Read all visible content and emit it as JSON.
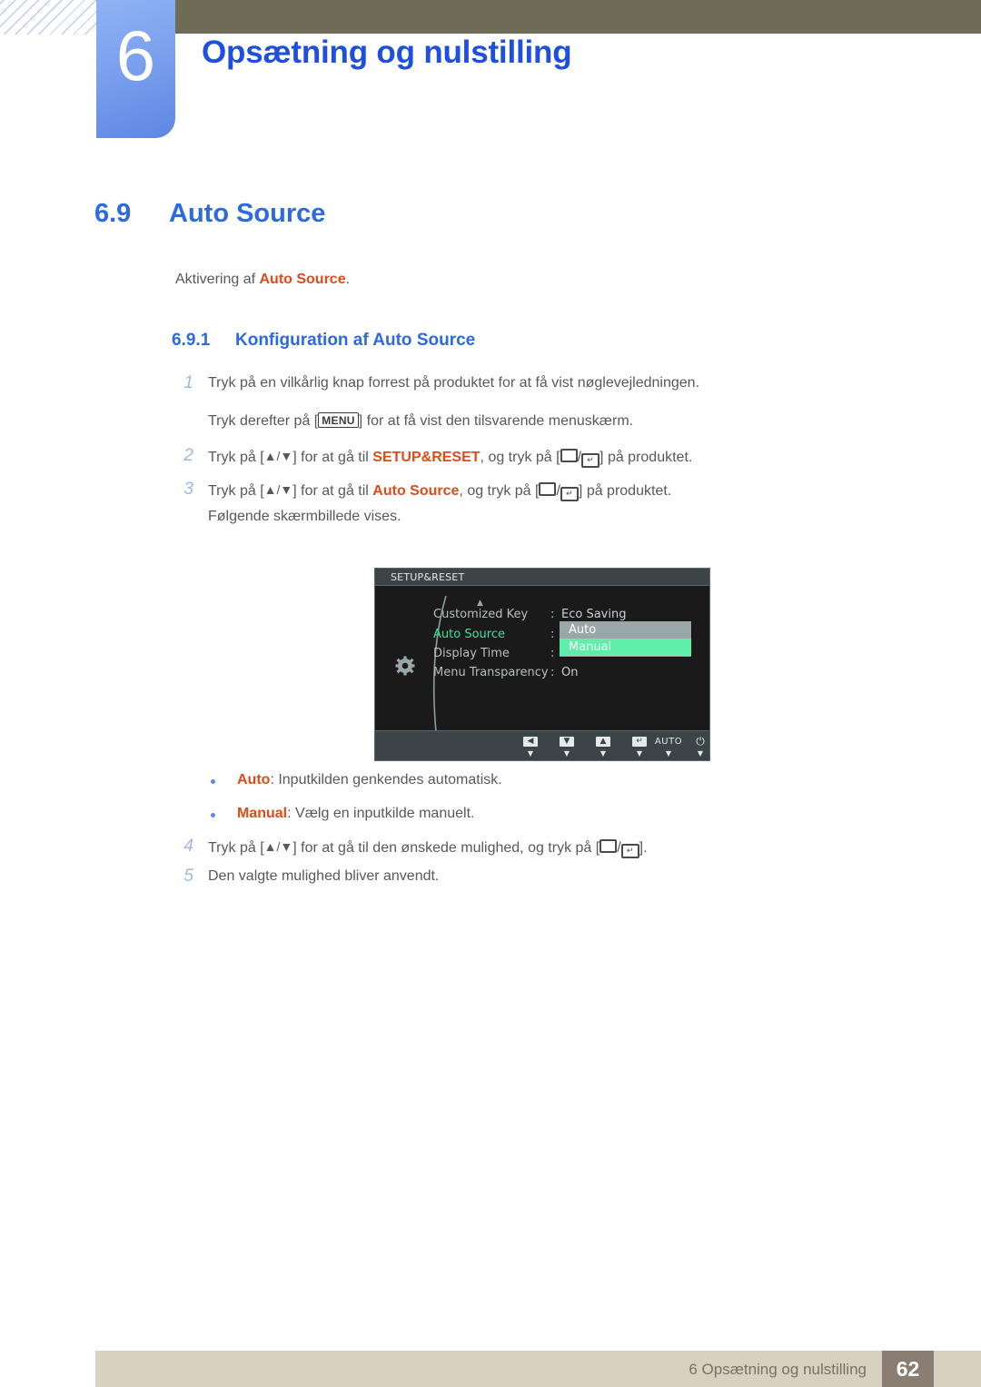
{
  "header": {
    "chapter_number": "6",
    "chapter_title": "Opsætning og nulstilling",
    "accent_blue": "#1f4fe0",
    "olive": "#6e6b56"
  },
  "section": {
    "number": "6.9",
    "title": "Auto Source",
    "intro_prefix": "Aktivering af ",
    "intro_highlight": "Auto Source",
    "intro_suffix": "."
  },
  "subsection": {
    "number": "6.9.1",
    "title": "Konfiguration af Auto Source"
  },
  "steps": [
    {
      "num": "1",
      "parts": [
        {
          "t": "Tryk på en vilkårlig knap forrest på produktet for at få vist nøglevejledningen."
        }
      ]
    },
    {
      "num": "",
      "parts": [
        {
          "t": "Tryk derefter på ["
        },
        {
          "key": "MENU"
        },
        {
          "t": "] for at få vist den tilsvarende menuskærm."
        }
      ]
    },
    {
      "num": "2",
      "parts": [
        {
          "t": "Tryk på ["
        },
        {
          "tri": "▲/▼"
        },
        {
          "t": "] for at gå til "
        },
        {
          "hl": "SETUP&RESET"
        },
        {
          "t": ", og tryk på ["
        },
        {
          "rect": true
        },
        {
          "t": "/"
        },
        {
          "enter": true
        },
        {
          "t": "] på produktet."
        }
      ]
    },
    {
      "num": "3",
      "parts": [
        {
          "t": "Tryk på ["
        },
        {
          "tri": "▲/▼"
        },
        {
          "t": "] for at gå til "
        },
        {
          "hl": "Auto Source"
        },
        {
          "t": ", og tryk på ["
        },
        {
          "rect": true
        },
        {
          "t": "/"
        },
        {
          "enter": true
        },
        {
          "t": "] på produktet."
        }
      ]
    },
    {
      "num": "",
      "parts": [
        {
          "t": "Følgende skærmbillede vises."
        }
      ]
    },
    {
      "num": "4",
      "parts": [
        {
          "t": "Tryk på ["
        },
        {
          "tri": "▲/▼"
        },
        {
          "t": "] for at gå til den ønskede mulighed, og tryk på ["
        },
        {
          "rect": true
        },
        {
          "t": "/"
        },
        {
          "enter": true
        },
        {
          "t": "]."
        }
      ]
    },
    {
      "num": "5",
      "parts": [
        {
          "t": "Den valgte mulighed bliver anvendt."
        }
      ]
    }
  ],
  "bullets": [
    {
      "term": "Auto",
      "desc": ": Inputkilden genkendes automatisk."
    },
    {
      "term": "Manual",
      "desc": ": Vælg en inputkilde manuelt."
    }
  ],
  "osd": {
    "title": "SETUP&RESET",
    "scroll_up_indicator": "▲",
    "rows": [
      {
        "label": "Customized Key",
        "colon": ":",
        "value": "Eco Saving",
        "active": false
      },
      {
        "label": "Auto Source",
        "colon": ":",
        "value": "",
        "active": true
      },
      {
        "label": "Display Time",
        "colon": ":",
        "value": "",
        "active": false
      },
      {
        "label": "Menu Transparency",
        "colon": ":",
        "value": "On",
        "active": false
      }
    ],
    "dropdown": {
      "options": [
        "Auto",
        "Manual"
      ],
      "selected": "Manual",
      "selected_color": "#5fefa8",
      "background_color": "#9aa6a8"
    },
    "buttons": [
      {
        "name": "back",
        "glyph": "◀",
        "caret": "▼"
      },
      {
        "name": "down",
        "glyph": "▼",
        "caret": "▼"
      },
      {
        "name": "up",
        "glyph": "▲",
        "caret": "▼"
      },
      {
        "name": "enter",
        "glyph": "↵",
        "caret": "▼"
      },
      {
        "name": "auto",
        "glyph": "AUTO",
        "caret": "▼"
      },
      {
        "name": "power",
        "glyph": "⏻",
        "caret": "▼"
      }
    ]
  },
  "footer": {
    "text": "6 Opsætning og nulstilling",
    "page": "62",
    "bar_color": "#d7d2bf",
    "page_box_color": "#8a7d71"
  }
}
